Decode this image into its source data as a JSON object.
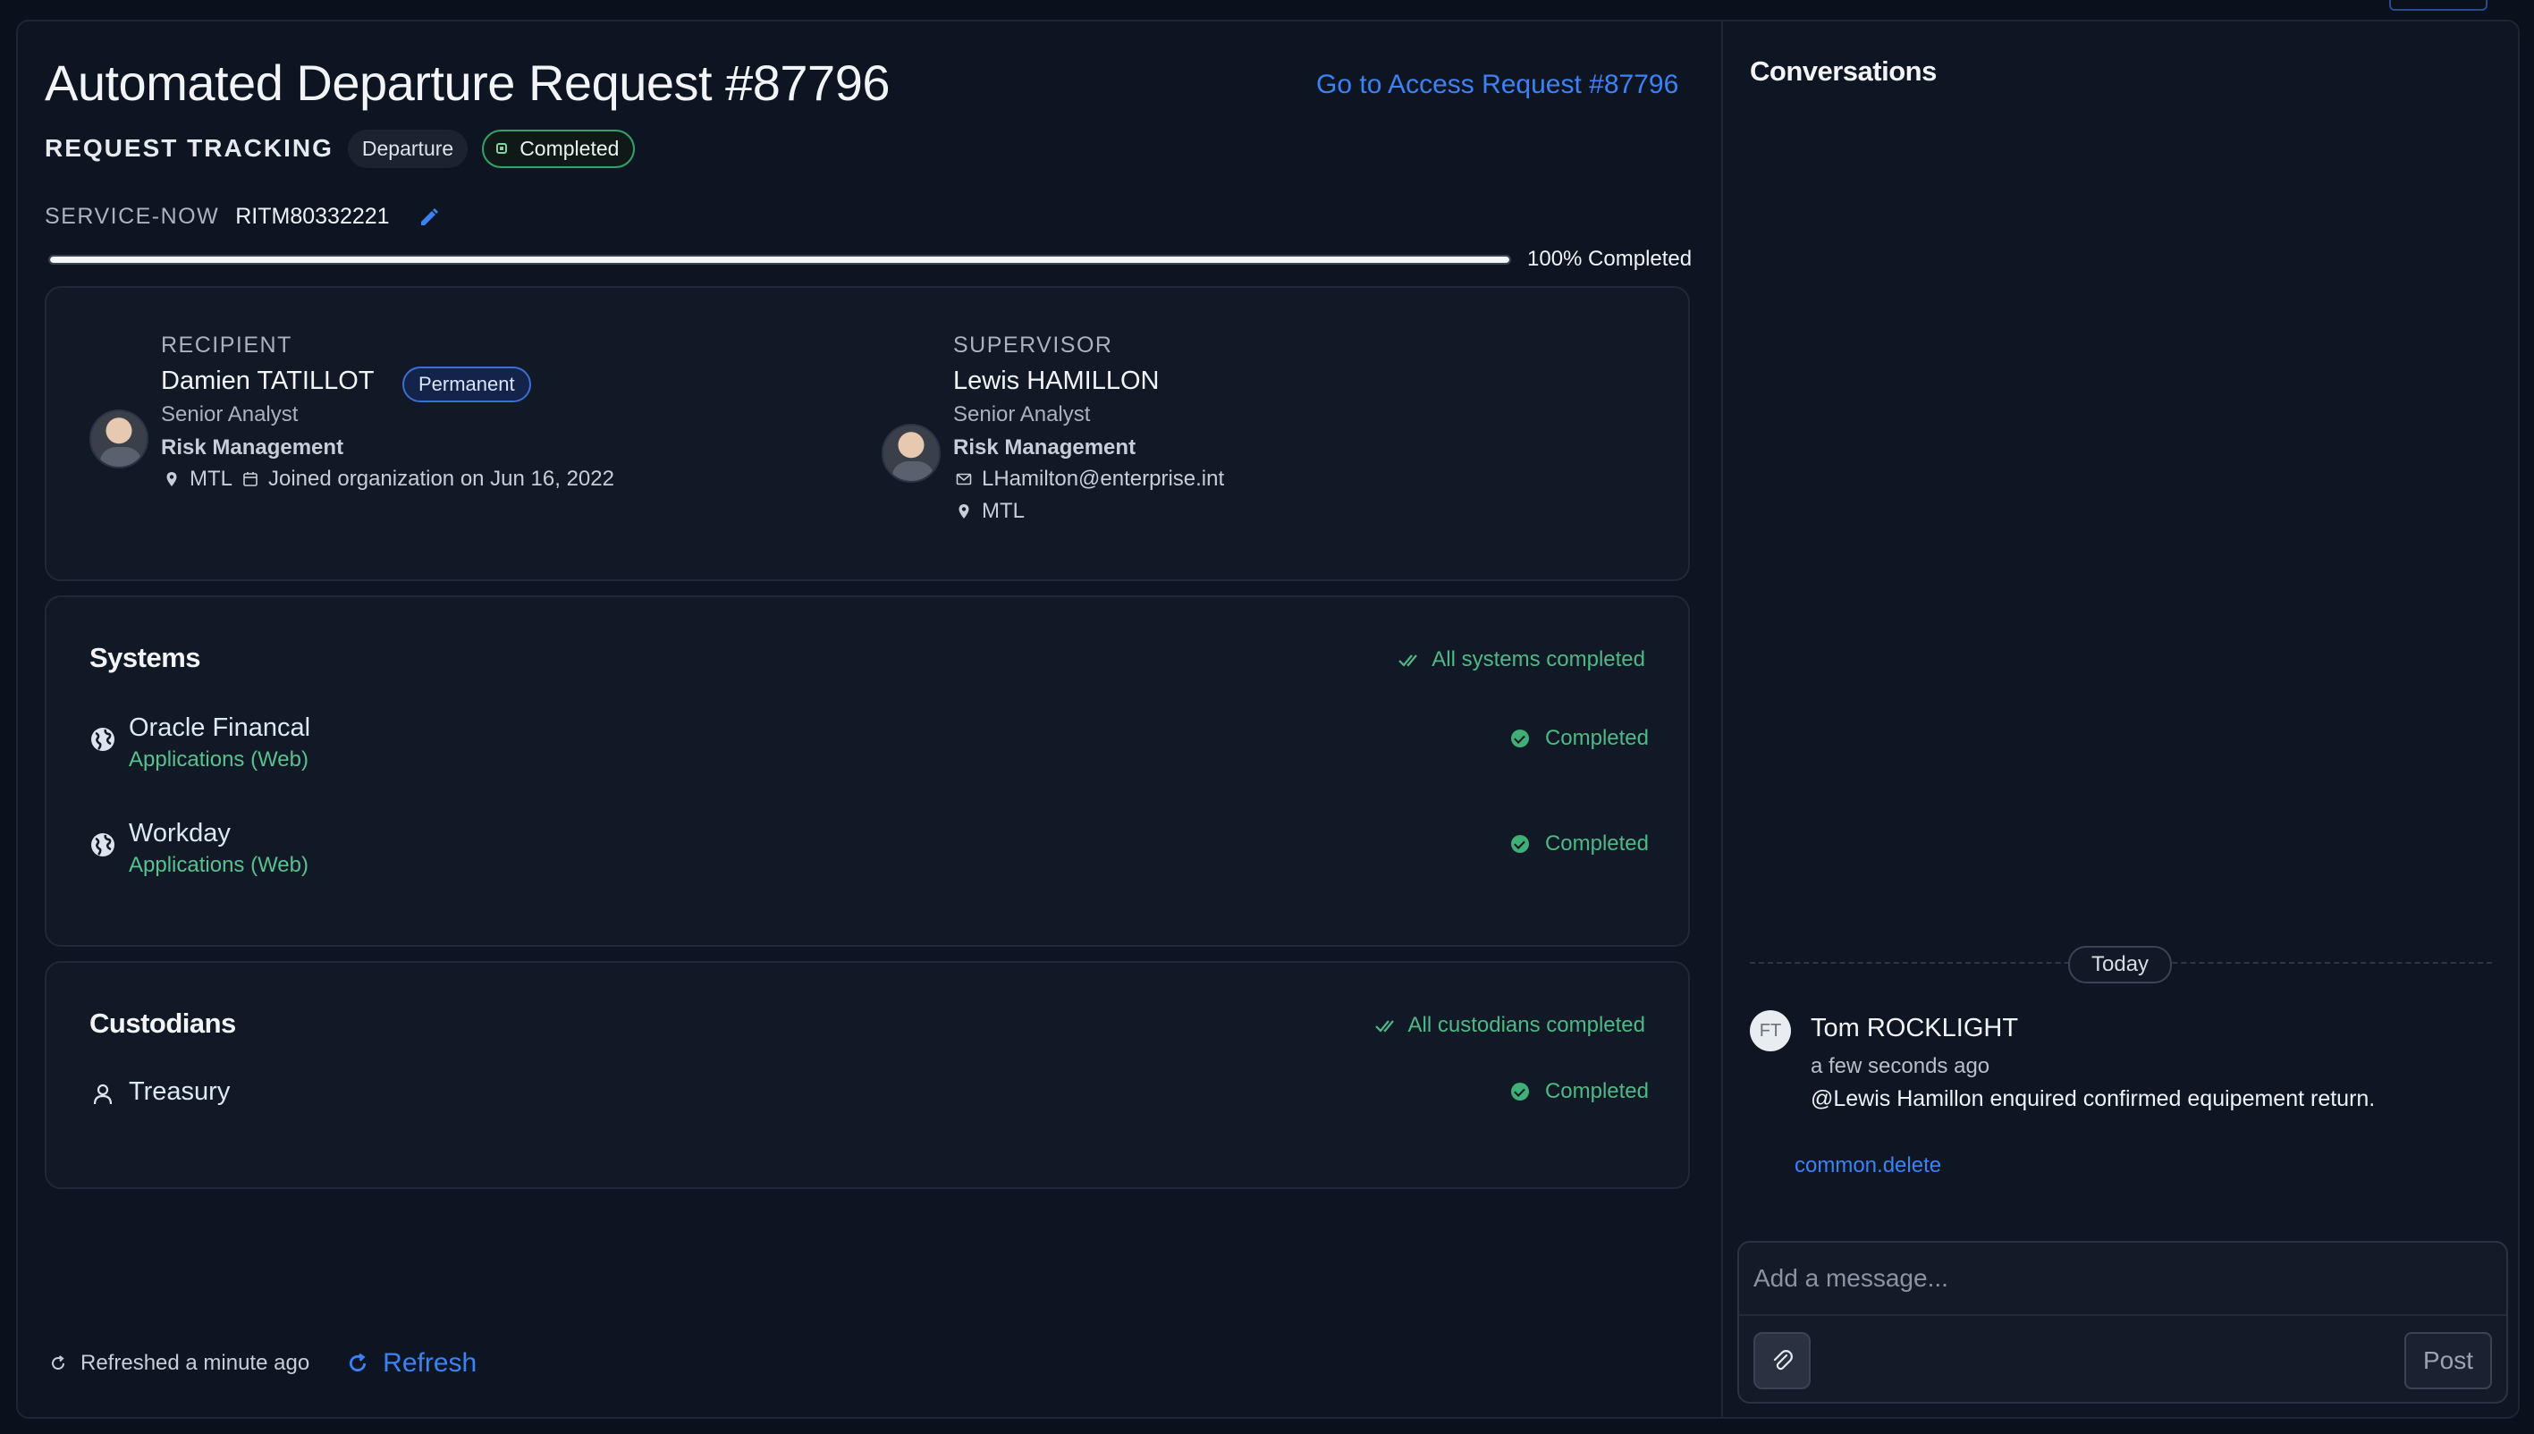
{
  "header": {
    "title": "Automated Departure Request #87796",
    "access_link": "Go to Access Request #87796",
    "tracking_label": "REQUEST TRACKING",
    "type_chip": "Departure",
    "status_chip": "Completed",
    "service_now_label": "SERVICE-NOW",
    "service_now_value": "RITM80332221",
    "progress_percent": 100,
    "progress_label": "100% Completed"
  },
  "recipient": {
    "role": "RECIPIENT",
    "name": "Damien TATILLOT",
    "badge": "Permanent",
    "title": "Senior Analyst",
    "department": "Risk Management",
    "location": "MTL",
    "joined": "Joined organization on Jun 16, 2022"
  },
  "supervisor": {
    "role": "SUPERVISOR",
    "name": "Lewis HAMILLON",
    "title": "Senior Analyst",
    "department": "Risk Management",
    "email": "LHamilton@enterprise.int",
    "location": "MTL"
  },
  "systems": {
    "title": "Systems",
    "status": "All systems completed",
    "items": [
      {
        "name": "Oracle Financal",
        "type": "Applications (Web)",
        "status": "Completed"
      },
      {
        "name": "Workday",
        "type": "Applications (Web)",
        "status": "Completed"
      }
    ]
  },
  "custodians": {
    "title": "Custodians",
    "status": "All custodians completed",
    "items": [
      {
        "name": "Treasury",
        "status": "Completed"
      }
    ]
  },
  "footer": {
    "refreshed": "Refreshed a minute ago",
    "refresh_button": "Refresh"
  },
  "conversations": {
    "title": "Conversations",
    "divider": "Today",
    "messages": [
      {
        "initials": "FT",
        "author": "Tom ROCKLIGHT",
        "time": "a few seconds ago",
        "text": "@Lewis Hamillon enquired confirmed equipement return.",
        "delete_label": "common.delete"
      }
    ],
    "composer_placeholder": "Add a message...",
    "post_label": "Post"
  },
  "colors": {
    "accent": "#3b82f6",
    "success": "#4fb985",
    "background": "#0e1522"
  }
}
